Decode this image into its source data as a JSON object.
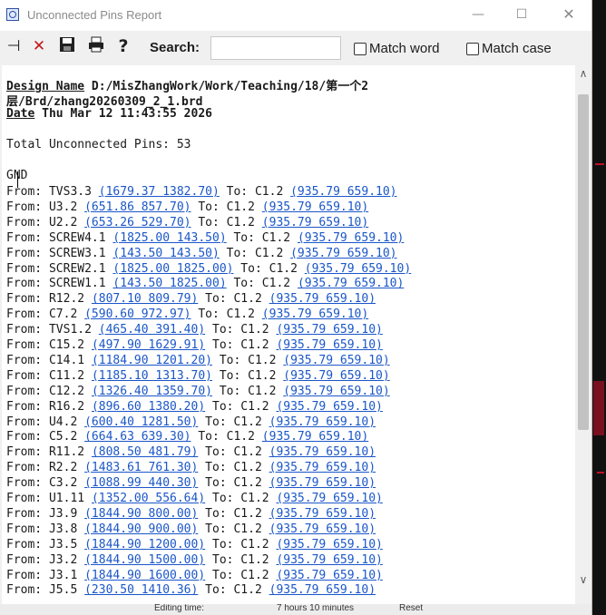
{
  "window": {
    "title": "Unconnected Pins Report",
    "app_icon": "report-icon"
  },
  "toolbar": {
    "buttons": [
      {
        "name": "pin-icon",
        "glyph": "⊣"
      },
      {
        "name": "close-red-icon",
        "glyph": "✕"
      },
      {
        "name": "save-icon",
        "glyph": "💾"
      },
      {
        "name": "print-icon",
        "glyph": "🖶"
      },
      {
        "name": "help-icon",
        "glyph": "?"
      }
    ],
    "search_label": "Search:",
    "search_value": "",
    "match_word": "Match word",
    "match_case": "Match case"
  },
  "report": {
    "design_label": "Design Name",
    "design_value_1": "D:/MisZhangWork/Work/Teaching/18/第一个2",
    "design_value_2": "层/Brd/zhang20260309_2_1.brd",
    "date_label": "Date",
    "date_value": "Thu Mar 12 11:43:55 2026",
    "total": "Total Unconnected Pins: 53",
    "net": "GND",
    "rows": [
      {
        "from": "From: ",
        "pin": "TVS3.3 ",
        "from_coord": "(1679.37 1382.70)",
        "to": " To: C1.2 ",
        "to_coord": "(935.79 659.10)"
      },
      {
        "from": "From: ",
        "pin": "U3.2 ",
        "from_coord": "(651.86 857.70)",
        "to": " To: C1.2 ",
        "to_coord": "(935.79 659.10)"
      },
      {
        "from": "From: ",
        "pin": "U2.2 ",
        "from_coord": "(653.26 529.70)",
        "to": " To: C1.2 ",
        "to_coord": "(935.79 659.10)"
      },
      {
        "from": "From: ",
        "pin": "SCREW4.1 ",
        "from_coord": "(1825.00 143.50)",
        "to": " To: C1.2 ",
        "to_coord": "(935.79 659.10)"
      },
      {
        "from": "From: ",
        "pin": "SCREW3.1 ",
        "from_coord": "(143.50 143.50)",
        "to": " To: C1.2 ",
        "to_coord": "(935.79 659.10)"
      },
      {
        "from": "From: ",
        "pin": "SCREW2.1 ",
        "from_coord": "(1825.00 1825.00)",
        "to": " To: C1.2 ",
        "to_coord": "(935.79 659.10)"
      },
      {
        "from": "From: ",
        "pin": "SCREW1.1 ",
        "from_coord": "(143.50 1825.00)",
        "to": " To: C1.2 ",
        "to_coord": "(935.79 659.10)"
      },
      {
        "from": "From: ",
        "pin": "R12.2 ",
        "from_coord": "(807.10 809.79)",
        "to": " To: C1.2 ",
        "to_coord": "(935.79 659.10)"
      },
      {
        "from": "From: ",
        "pin": "C7.2 ",
        "from_coord": "(590.60 972.97)",
        "to": " To: C1.2 ",
        "to_coord": "(935.79 659.10)"
      },
      {
        "from": "From: ",
        "pin": "TVS1.2 ",
        "from_coord": "(465.40 391.40)",
        "to": " To: C1.2 ",
        "to_coord": "(935.79 659.10)"
      },
      {
        "from": "From: ",
        "pin": "C15.2 ",
        "from_coord": "(497.90 1629.91)",
        "to": " To: C1.2 ",
        "to_coord": "(935.79 659.10)"
      },
      {
        "from": "From: ",
        "pin": "C14.1 ",
        "from_coord": "(1184.90 1201.20)",
        "to": " To: C1.2 ",
        "to_coord": "(935.79 659.10)"
      },
      {
        "from": "From: ",
        "pin": "C11.2 ",
        "from_coord": "(1185.10 1313.70)",
        "to": " To: C1.2 ",
        "to_coord": "(935.79 659.10)"
      },
      {
        "from": "From: ",
        "pin": "C12.2 ",
        "from_coord": "(1326.40 1359.70)",
        "to": " To: C1.2 ",
        "to_coord": "(935.79 659.10)"
      },
      {
        "from": "From: ",
        "pin": "R16.2 ",
        "from_coord": "(896.60 1380.20)",
        "to": " To: C1.2 ",
        "to_coord": "(935.79 659.10)"
      },
      {
        "from": "From: ",
        "pin": "U4.2 ",
        "from_coord": "(600.40 1281.50)",
        "to": " To: C1.2 ",
        "to_coord": "(935.79 659.10)"
      },
      {
        "from": "From: ",
        "pin": "C5.2 ",
        "from_coord": "(664.63 639.30)",
        "to": " To: C1.2 ",
        "to_coord": "(935.79 659.10)"
      },
      {
        "from": "From: ",
        "pin": "R11.2 ",
        "from_coord": "(808.50 481.79)",
        "to": " To: C1.2 ",
        "to_coord": "(935.79 659.10)"
      },
      {
        "from": "From: ",
        "pin": "R2.2 ",
        "from_coord": "(1483.61 761.30)",
        "to": " To: C1.2 ",
        "to_coord": "(935.79 659.10)"
      },
      {
        "from": "From: ",
        "pin": "C3.2 ",
        "from_coord": "(1088.99 440.30)",
        "to": " To: C1.2 ",
        "to_coord": "(935.79 659.10)"
      },
      {
        "from": "From: ",
        "pin": "U1.11 ",
        "from_coord": "(1352.00 556.64)",
        "to": " To: C1.2 ",
        "to_coord": "(935.79 659.10)"
      },
      {
        "from": "From: ",
        "pin": "J3.9 ",
        "from_coord": "(1844.90 800.00)",
        "to": " To: C1.2 ",
        "to_coord": "(935.79 659.10)"
      },
      {
        "from": "From: ",
        "pin": "J3.8 ",
        "from_coord": "(1844.90 900.00)",
        "to": " To: C1.2 ",
        "to_coord": "(935.79 659.10)"
      },
      {
        "from": "From: ",
        "pin": "J3.5 ",
        "from_coord": "(1844.90 1200.00)",
        "to": " To: C1.2 ",
        "to_coord": "(935.79 659.10)"
      },
      {
        "from": "From: ",
        "pin": "J3.2 ",
        "from_coord": "(1844.90 1500.00)",
        "to": " To: C1.2 ",
        "to_coord": "(935.79 659.10)"
      },
      {
        "from": "From: ",
        "pin": "J3.1 ",
        "from_coord": "(1844.90 1600.00)",
        "to": " To: C1.2 ",
        "to_coord": "(935.79 659.10)"
      },
      {
        "from": "From: ",
        "pin": "J5.5 ",
        "from_coord": "(230.50 1410.36)",
        "to": " To: C1.2 ",
        "to_coord": "(935.79 659.10)"
      }
    ]
  },
  "statusbar": {
    "editing_time_label": "Editing time:",
    "editing_time_value": "7 hours 10 minutes",
    "reset": "Reset"
  },
  "colors": {
    "link": "#1a56c8",
    "background_trace": "#c0102a"
  }
}
